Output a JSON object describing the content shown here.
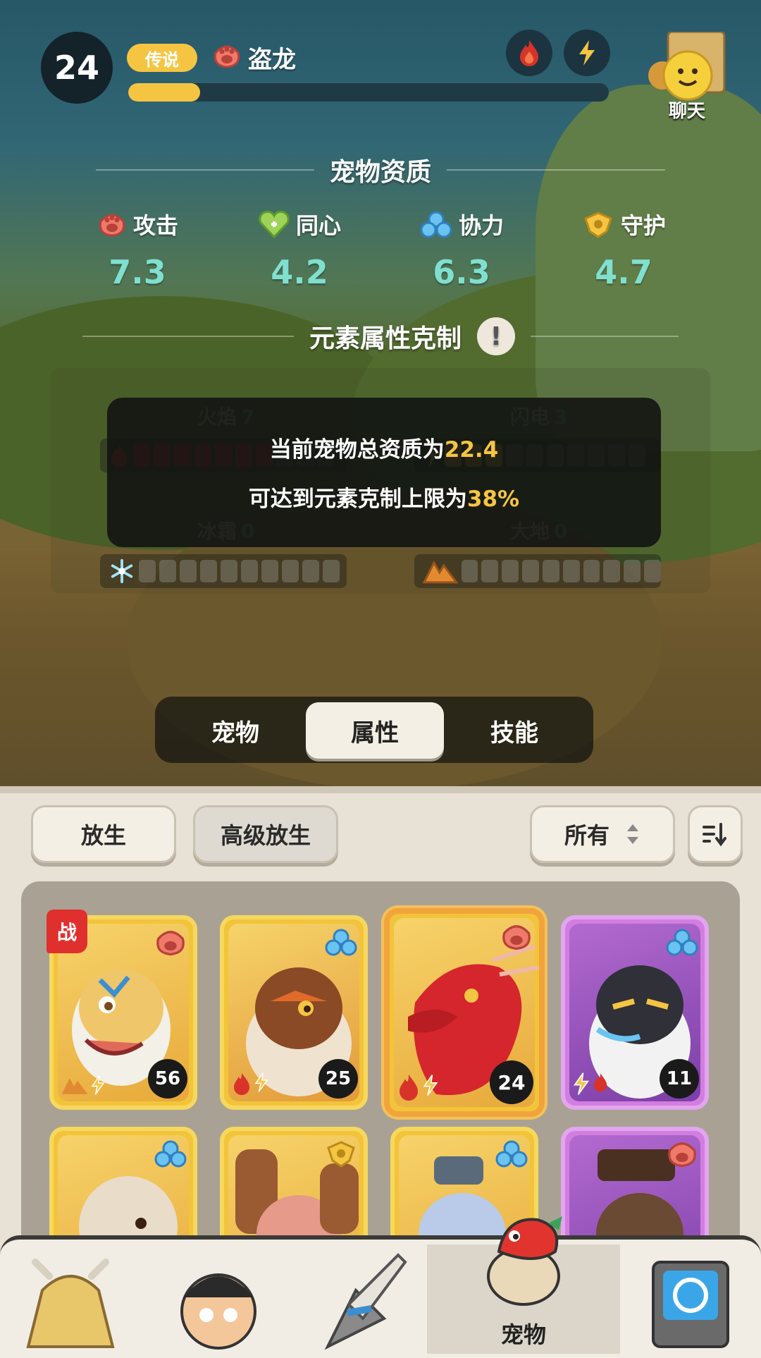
{
  "header": {
    "level": "24",
    "rarity": "传说",
    "pet_name": "盗龙",
    "xp_progress": 0.15,
    "chat_label": "聊天"
  },
  "aptitude": {
    "title": "宠物资质",
    "stats": [
      {
        "name": "攻击",
        "value": "7.3",
        "icon": "attack-icon"
      },
      {
        "name": "同心",
        "value": "4.2",
        "icon": "heart-icon"
      },
      {
        "name": "协力",
        "value": "6.3",
        "icon": "cooperation-icon"
      },
      {
        "name": "守护",
        "value": "4.7",
        "icon": "guard-icon"
      }
    ]
  },
  "elements": {
    "title": "元素属性克制",
    "rows": [
      {
        "name": "火焰",
        "count": "7"
      },
      {
        "name": "闪电",
        "count": "3"
      },
      {
        "name": "冰霜",
        "count": "0"
      },
      {
        "name": "大地",
        "count": "0"
      }
    ],
    "tooltip": {
      "line1_prefix": "当前宠物总资质为",
      "line1_value": "22.4",
      "line2_prefix": "可达到元素克制上限为",
      "line2_value": "38%"
    }
  },
  "tabs": [
    {
      "label": "宠物"
    },
    {
      "label": "属性"
    },
    {
      "label": "技能"
    }
  ],
  "toolbar": {
    "release": "放生",
    "advanced_release": "高级放生",
    "filter": "所有"
  },
  "pets": [
    {
      "level": "56",
      "frame": "gold",
      "tag": "战",
      "role": "attack-icon",
      "elements": [
        "earth",
        "lightning"
      ]
    },
    {
      "level": "25",
      "frame": "gold",
      "role": "cooperation-icon",
      "elements": [
        "fire",
        "lightning"
      ]
    },
    {
      "level": "24",
      "frame": "gold",
      "role": "attack-icon",
      "elements": [
        "fire",
        "lightning"
      ],
      "selected": true
    },
    {
      "level": "11",
      "frame": "purple",
      "role": "cooperation-icon",
      "elements": [
        "lightning",
        "fire"
      ]
    },
    {
      "level": "",
      "frame": "gold",
      "role": "cooperation-icon"
    },
    {
      "level": "",
      "frame": "gold",
      "role": "guard-icon"
    },
    {
      "level": "",
      "frame": "gold",
      "role": "cooperation-icon"
    },
    {
      "level": "",
      "frame": "purple",
      "role": "attack-icon"
    }
  ],
  "nav": [
    {
      "label": ""
    },
    {
      "label": ""
    },
    {
      "label": ""
    },
    {
      "label": "宠物"
    },
    {
      "label": ""
    }
  ],
  "colors": {
    "accent_gold": "#f5c542",
    "stat_value": "#7fe0cf",
    "fire": "#d8332b",
    "lightning": "#f5c542"
  }
}
